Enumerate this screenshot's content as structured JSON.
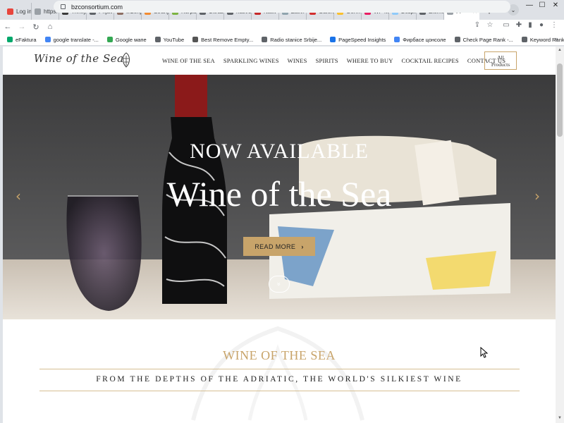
{
  "browser": {
    "tabs": [
      {
        "label": "Log in",
        "color": "#e8453c"
      },
      {
        "label": "https:",
        "color": "#9aa0a6"
      },
      {
        "label": "Trinity",
        "color": "#3a3a3a"
      },
      {
        "label": "Prijav",
        "color": "#5f6368"
      },
      {
        "label": "Inženj",
        "color": "#8d6e63"
      },
      {
        "label": "Stranj",
        "color": "#f28b30"
      },
      {
        "label": "Korpa",
        "color": "#7cb342"
      },
      {
        "label": "Ultras",
        "color": "#5f6368"
      },
      {
        "label": "nativo",
        "color": "#5f6368"
      },
      {
        "label": "Nativ",
        "color": "#c62828"
      },
      {
        "label": "Zalivi",
        "color": "#90a4ae"
      },
      {
        "label": "Galeri",
        "color": "#d32f2f"
      },
      {
        "label": "Germ",
        "color": "#fbc02d"
      },
      {
        "label": "WP M",
        "color": "#e91e63"
      },
      {
        "label": "Besplt",
        "color": "#90caf9"
      },
      {
        "label": "Eleme",
        "color": "#5f6368"
      },
      {
        "label": "Fi",
        "color": "#9aa0a6"
      }
    ],
    "new_tab": "+",
    "tab_dropdown": "⌄",
    "window_controls": [
      "—",
      "☐",
      "✕"
    ],
    "url": "bzconsortium.com",
    "bookmarks": [
      {
        "label": "eFaktura",
        "color": "#00a86b"
      },
      {
        "label": "google translate -...",
        "color": "#4285f4"
      },
      {
        "label": "Google мапе",
        "color": "#34a853"
      },
      {
        "label": "YouTube",
        "color": "#5f6368"
      },
      {
        "label": "Best Remove Empty...",
        "color": "#555555"
      },
      {
        "label": "Radio stanice Srbije...",
        "color": "#5f6368"
      },
      {
        "label": "PageSpeed Insights",
        "color": "#1a73e8"
      },
      {
        "label": "Фирбасе цонсоле",
        "color": "#4285f4"
      },
      {
        "label": "Check Page Rank -...",
        "color": "#5f6368"
      },
      {
        "label": "Keyword Rank Chec...",
        "color": "#5f6368"
      }
    ],
    "bookmarks_more": "»"
  },
  "site": {
    "logo_text": "Wine of the Sea",
    "nav": [
      "WINE OF THE SEA",
      "SPARKLING WINES",
      "WINES",
      "SPIRITS",
      "WHERE TO BUY",
      "COCKTAIL RECIPES",
      "CONTACT US"
    ],
    "all_products": [
      "All",
      "Products"
    ],
    "hero": {
      "kicker": "NOW AVAILABLE",
      "title": "Wine of the Sea",
      "button": "READ MORE",
      "button_icon": "›",
      "prev": "‹",
      "next": "›",
      "scroll_icon": "»"
    },
    "section_title": "WINE OF THE SEA",
    "section_subtitle": "FROM THE DEPTHS OF THE ADRIATIC, THE WORLD'S SILKIEST WINE"
  },
  "colors": {
    "accent_gold": "#c8a46a"
  }
}
